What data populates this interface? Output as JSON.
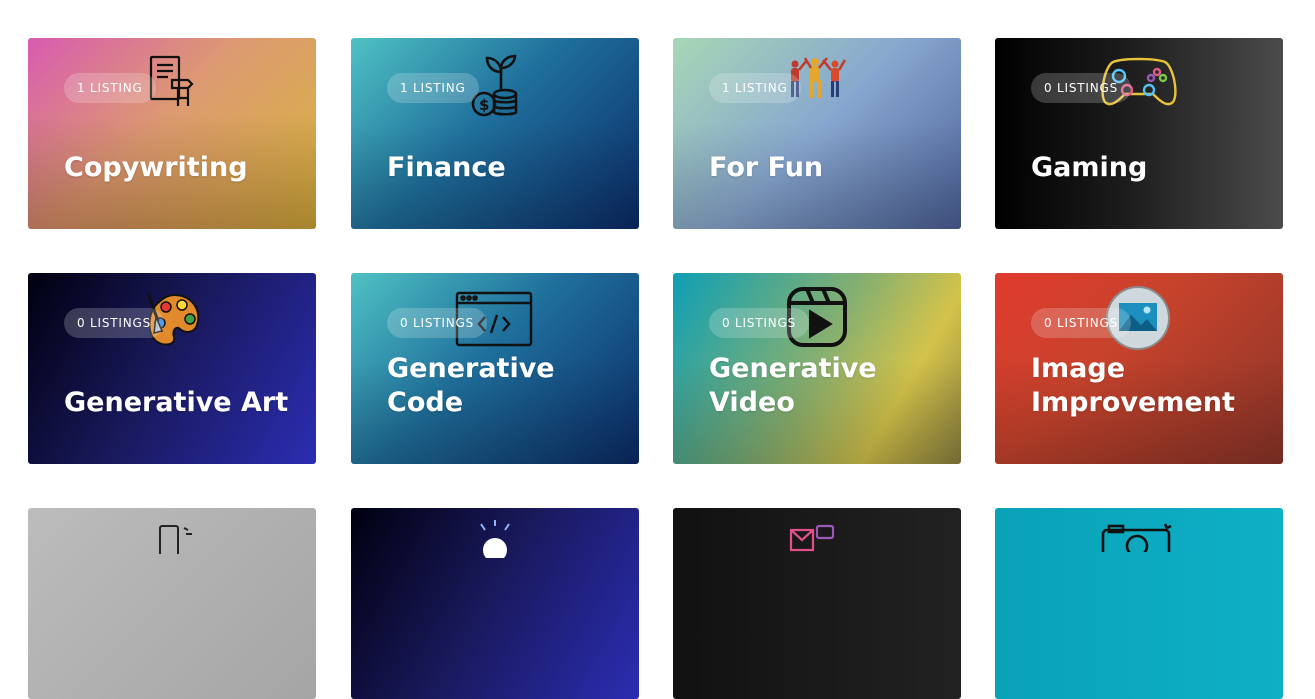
{
  "categories": [
    {
      "title": "Copywriting",
      "listings": "1 LISTING",
      "icon": "document-writing-icon",
      "gradient": [
        "#d85bb0",
        "#dd9a72",
        "#d6b63a"
      ]
    },
    {
      "title": "Finance",
      "listings": "1 LISTING",
      "icon": "money-plant-icon",
      "gradient": [
        "#4fc2c4",
        "#1f6f9c",
        "#0a2a66"
      ]
    },
    {
      "title": "For Fun",
      "listings": "1 LISTING",
      "icon": "dancing-people-icon",
      "gradient": [
        "#a7d7b5",
        "#87a6cf",
        "#4a5f96"
      ]
    },
    {
      "title": "Gaming",
      "listings": "0 LISTINGS",
      "icon": "gamepad-icon",
      "gradient": [
        "#000000",
        "#1c1c1c",
        "#4b4b4b"
      ]
    },
    {
      "title": "Generative Art",
      "listings": "0 LISTINGS",
      "icon": "paint-palette-icon",
      "gradient": [
        "#000010",
        "#181859",
        "#2b2db2"
      ]
    },
    {
      "title": "Generative Code",
      "listings": "0 LISTINGS",
      "icon": "code-window-icon",
      "gradient": [
        "#4fc2c4",
        "#1f6f9c",
        "#0a2a66"
      ]
    },
    {
      "title": "Generative Video",
      "listings": "0 LISTINGS",
      "icon": "video-play-icon",
      "gradient": [
        "#0e9fb5",
        "#89b06e",
        "#d4c34a"
      ]
    },
    {
      "title": "Image Improvement",
      "listings": "0 LISTINGS",
      "icon": "image-icon",
      "gradient": [
        "#e03a2e",
        "#c7432c",
        "#8a3428"
      ]
    },
    {
      "title": "",
      "listings": "",
      "icon": "phone-scan-icon",
      "gradient": [
        "#bcbcbc",
        "#a5a5a5"
      ]
    },
    {
      "title": "",
      "listings": "",
      "icon": "lightbulb-icon",
      "gradient": [
        "#000010",
        "#2b2db2"
      ]
    },
    {
      "title": "",
      "listings": "",
      "icon": "chat-mail-icon",
      "gradient": [
        "#111111",
        "#222222"
      ]
    },
    {
      "title": "",
      "listings": "",
      "icon": "camera-icon",
      "gradient": [
        "#0aa2b8",
        "#0eb0c6"
      ]
    }
  ]
}
